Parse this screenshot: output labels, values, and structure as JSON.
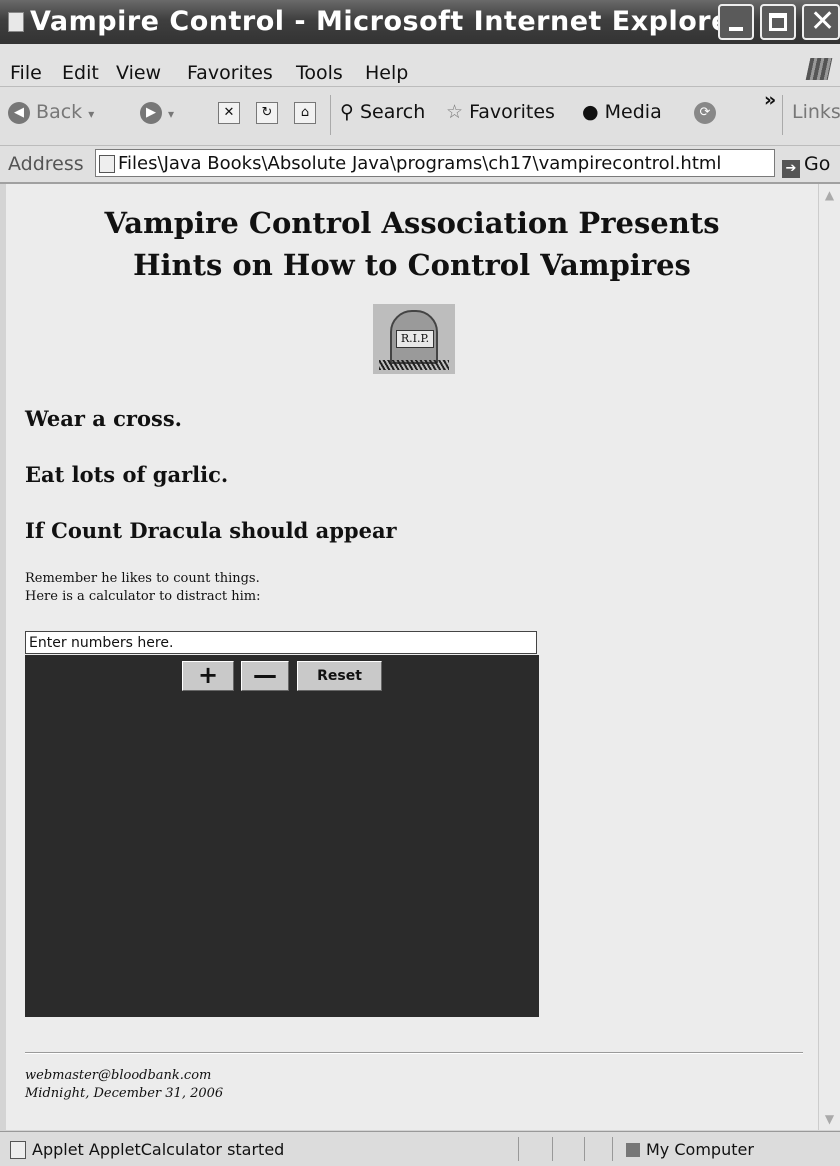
{
  "window": {
    "title": "Vampire Control - Microsoft Internet Explorer"
  },
  "menu": [
    "File",
    "Edit",
    "View",
    "Favorites",
    "Tools",
    "Help"
  ],
  "toolbar": {
    "back": "Back",
    "search": "Search",
    "favorites": "Favorites",
    "media": "Media",
    "links": "Links",
    "overflow": "»"
  },
  "address": {
    "label": "Address",
    "url": "Files\\Java Books\\Absolute Java\\programs\\ch17\\vampirecontrol.html",
    "go": "Go"
  },
  "page": {
    "heading1": "Vampire Control Association Presents",
    "heading2": "Hints on How to Control Vampires",
    "image_label": "R.I.P.",
    "hint1": "Wear a cross.",
    "hint2": "Eat lots of garlic.",
    "hint3": "If Count Dracula should appear",
    "note1": "Remember he likes to count things.",
    "note2": "Here is a calculator to distract him:"
  },
  "applet": {
    "input_value": "Enter numbers here.",
    "plus": "+",
    "minus": "—",
    "reset": "Reset",
    "panel_color": "#2b2b2b"
  },
  "footer": {
    "email": "webmaster@bloodbank.com",
    "date": "Midnight, December 31, 2006"
  },
  "status": {
    "text": "Applet AppletCalculator started",
    "zone": "My Computer"
  }
}
